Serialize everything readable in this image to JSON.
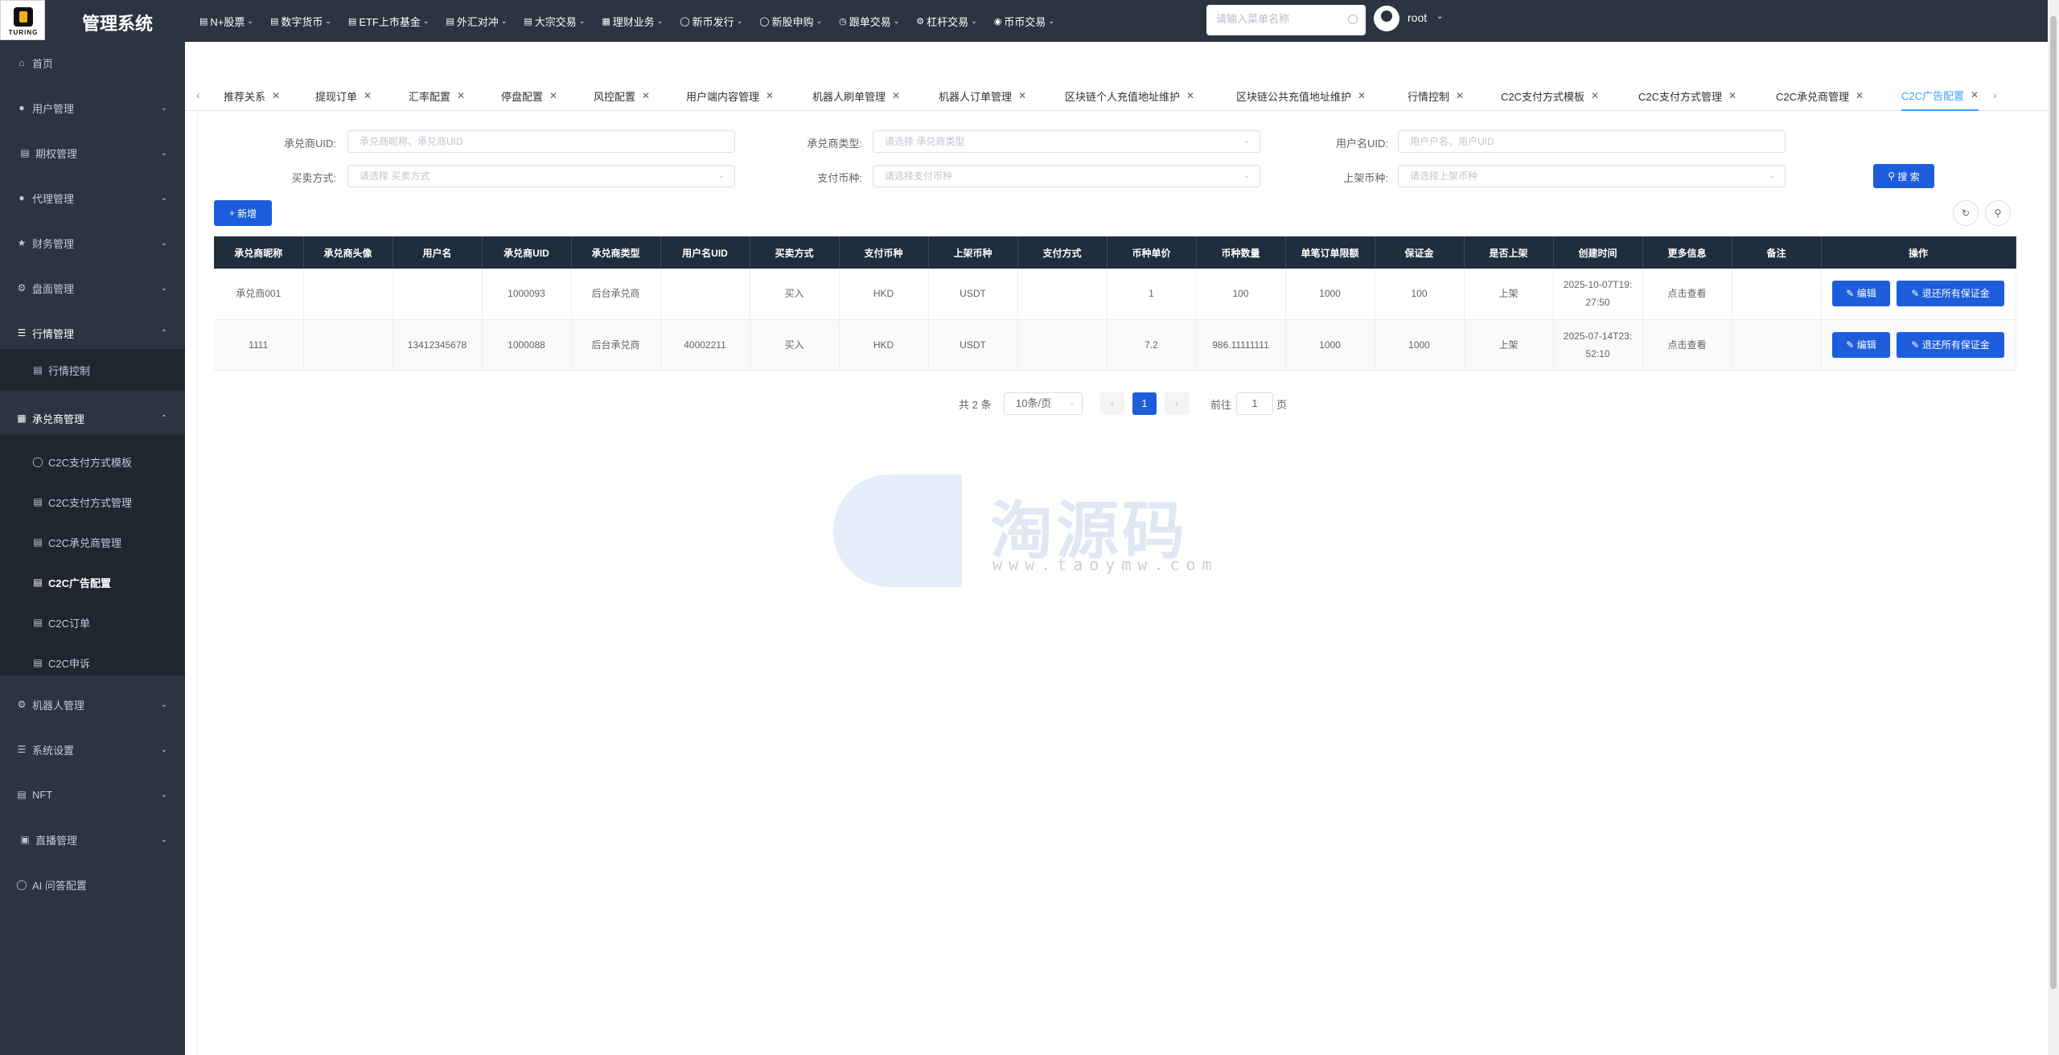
{
  "header": {
    "logo_text": "TURING",
    "title": "管理系统",
    "nav": [
      {
        "label": "N+股票",
        "icon": "bar-chart-icon"
      },
      {
        "label": "数字货币",
        "icon": "bar-chart-icon"
      },
      {
        "label": "ETF上市基金",
        "icon": "bar-chart-icon"
      },
      {
        "label": "外汇对冲",
        "icon": "bar-chart-icon"
      },
      {
        "label": "大宗交易",
        "icon": "bar-chart-icon"
      },
      {
        "label": "理财业务",
        "icon": "wallet-icon"
      },
      {
        "label": "新币发行",
        "icon": "coin-icon"
      },
      {
        "label": "新股申购",
        "icon": "coin-icon"
      },
      {
        "label": "跟单交易",
        "icon": "clock-icon"
      },
      {
        "label": "杠杆交易",
        "icon": "gear-icon"
      },
      {
        "label": "币币交易",
        "icon": "location-icon"
      }
    ],
    "search_placeholder": "请输入菜单名称",
    "username": "root"
  },
  "sidebar": {
    "items": [
      {
        "label": "首页",
        "icon": "home-icon"
      },
      {
        "label": "用户管理",
        "icon": "user-icon"
      },
      {
        "label": "期权管理",
        "icon": "chart-icon"
      },
      {
        "label": "代理管理",
        "icon": "user-icon"
      },
      {
        "label": "财务管理",
        "icon": "star-icon"
      },
      {
        "label": "盘面管理",
        "icon": "gear-icon"
      },
      {
        "label": "行情管理",
        "icon": "list-icon"
      },
      {
        "label": "行情控制",
        "icon": "doc-icon"
      },
      {
        "label": "承兑商管理",
        "icon": "table-icon"
      },
      {
        "label": "C2C支付方式模板",
        "icon": "circle-icon"
      },
      {
        "label": "C2C支付方式管理",
        "icon": "doc-icon"
      },
      {
        "label": "C2C承兑商管理",
        "icon": "doc-icon"
      },
      {
        "label": "C2C广告配置",
        "icon": "doc-icon"
      },
      {
        "label": "C2C订单",
        "icon": "doc-icon"
      },
      {
        "label": "C2C申诉",
        "icon": "doc-icon"
      },
      {
        "label": "机器人管理",
        "icon": "gear-icon"
      },
      {
        "label": "系统设置",
        "icon": "list-icon"
      },
      {
        "label": "NFT",
        "icon": "chart-icon"
      },
      {
        "label": "直播管理",
        "icon": "video-icon"
      },
      {
        "label": "AI 问答配置",
        "icon": "circle-icon"
      }
    ]
  },
  "tabs": [
    "推荐关系",
    "提现订单",
    "汇率配置",
    "停盘配置",
    "风控配置",
    "用户端内容管理",
    "机器人刷单管理",
    "机器人订单管理",
    "区块链个人充值地址维护",
    "区块链公共充值地址维护",
    "行情控制",
    "C2C支付方式模板",
    "C2C支付方式管理",
    "C2C承兑商管理",
    "C2C广告配置"
  ],
  "filters": {
    "merchant_uid_label": "承兑商UID:",
    "merchant_uid_placeholder": "承兑商昵称、承兑商UID",
    "merchant_type_label": "承兑商类型:",
    "merchant_type_placeholder": "请选择 承兑商类型",
    "user_uid_label": "用户名UID:",
    "user_uid_placeholder": "用户户名、用户UID",
    "trade_type_label": "买卖方式:",
    "trade_type_placeholder": "请选择 买卖方式",
    "pay_coin_label": "支付币种:",
    "pay_coin_placeholder": "请选择支付币种",
    "list_coin_label": "上架币种:",
    "list_coin_placeholder": "请选择上架币种",
    "search_button": "搜 索",
    "add_button": "新增"
  },
  "table": {
    "columns": [
      "承兑商昵称",
      "承兑商头像",
      "用户名",
      "承兑商UID",
      "承兑商类型",
      "用户名UID",
      "买卖方式",
      "支付币种",
      "上架币种",
      "支付方式",
      "币种单价",
      "币种数量",
      "单笔订单限额",
      "保证金",
      "是否上架",
      "创建时间",
      "更多信息",
      "备注",
      "操作"
    ],
    "rows": [
      {
        "nickname": "承兑商001",
        "avatar": "",
        "username": "",
        "uid": "1000093",
        "type": "后台承兑商",
        "user_uid": "",
        "trade": "买入",
        "pay_coin": "HKD",
        "list_coin": "USDT",
        "pay_method": "",
        "price": "1",
        "amount": "100",
        "limit": "1000",
        "deposit": "100",
        "listed": "上架",
        "created_1": "2025-10-07T19:",
        "created_2": "27:50",
        "more": "点击查看",
        "remark": "",
        "edit": "编辑",
        "refund": "退还所有保证金"
      },
      {
        "nickname": "1111",
        "avatar": "",
        "username": "13412345678",
        "uid": "1000088",
        "type": "后台承兑商",
        "user_uid": "40002211",
        "trade": "买入",
        "pay_coin": "HKD",
        "list_coin": "USDT",
        "pay_method": "",
        "price": "7.2",
        "amount": "986.11111111",
        "limit": "1000",
        "deposit": "1000",
        "listed": "上架",
        "created_1": "2025-07-14T23:",
        "created_2": "52:10",
        "more": "点击查看",
        "remark": "",
        "edit": "编辑",
        "refund": "退还所有保证金"
      }
    ]
  },
  "pagination": {
    "total": "共 2 条",
    "page_size": "10条/页",
    "current_page": "1",
    "goto_label": "前往",
    "goto_value": "1",
    "page_unit": "页"
  },
  "watermark": {
    "big": "淘源码",
    "small": "www.taoymw.com"
  },
  "colors": {
    "header_bg": "#2b3440",
    "primary": "#1d5ddb",
    "table_header": "#1f2d3d",
    "red_text": "#e02020",
    "green_text": "#38b03f",
    "link": "#409eff"
  }
}
